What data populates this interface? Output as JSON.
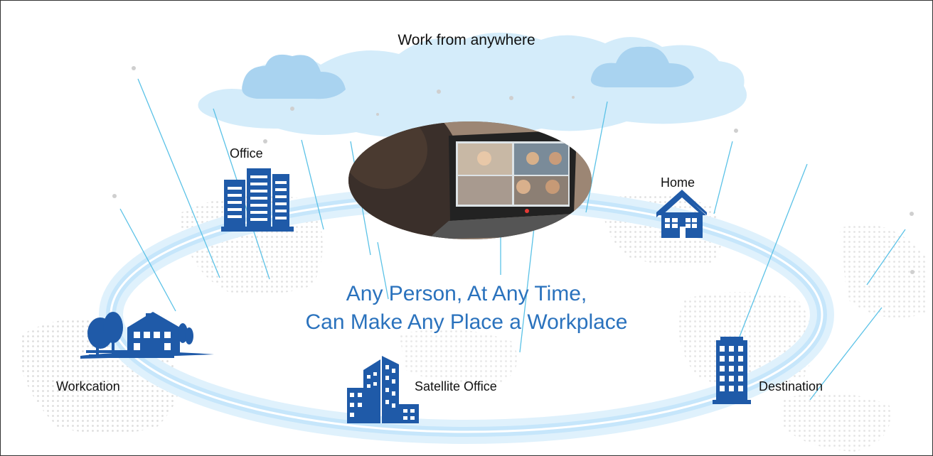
{
  "top_label": "Work from anywhere",
  "headline": {
    "line1": "Any Person, At Any Time,",
    "line2": "Can Make Any Place a Workplace"
  },
  "places": {
    "office": "Office",
    "home": "Home",
    "workcation": "Workcation",
    "satellite_office": "Satellite Office",
    "destination": "Destination"
  },
  "colors": {
    "icon_blue": "#1f5aa8",
    "headline_blue": "#2a72bd",
    "line_blue": "#5bc2e7",
    "cloud": "#d4ecfa",
    "ring_glow": "#cfe9fb"
  },
  "icons": [
    "cloud-icon",
    "office-building-icon",
    "house-icon",
    "workcation-house-icon",
    "satellite-office-icon",
    "destination-building-icon",
    "video-call-laptop-image"
  ]
}
